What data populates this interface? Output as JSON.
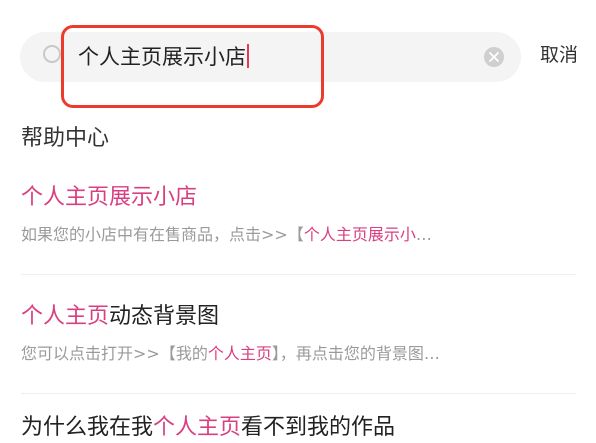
{
  "search": {
    "query": "个人主页展示小店",
    "cancel_label": "取消"
  },
  "section": {
    "title": "帮助中心"
  },
  "results": [
    {
      "title_parts": [
        {
          "text": "个人主页展示小店",
          "hl": true
        }
      ],
      "snippet_parts": [
        {
          "text": "如果您的小店中有在售商品，点击>>【",
          "hl": false
        },
        {
          "text": "个人主页展示小",
          "hl": true
        },
        {
          "text": "…",
          "hl": false
        }
      ]
    },
    {
      "title_parts": [
        {
          "text": "个人主页",
          "hl": true
        },
        {
          "text": "动态背景图",
          "hl": false
        }
      ],
      "snippet_parts": [
        {
          "text": "您可以点击打开>>【我的",
          "hl": false
        },
        {
          "text": "个人主页",
          "hl": true
        },
        {
          "text": "】，再点击您的背景图…",
          "hl": false
        }
      ]
    },
    {
      "title_parts": [
        {
          "text": "为什么我在我",
          "hl": false
        },
        {
          "text": "个人主页",
          "hl": true
        },
        {
          "text": "看不到我的作品",
          "hl": false
        }
      ]
    }
  ],
  "colors": {
    "highlight": "#d93f80",
    "annotation_box": "#ec3b2c"
  },
  "icons": {
    "search": "search-icon",
    "clear": "clear-icon"
  }
}
